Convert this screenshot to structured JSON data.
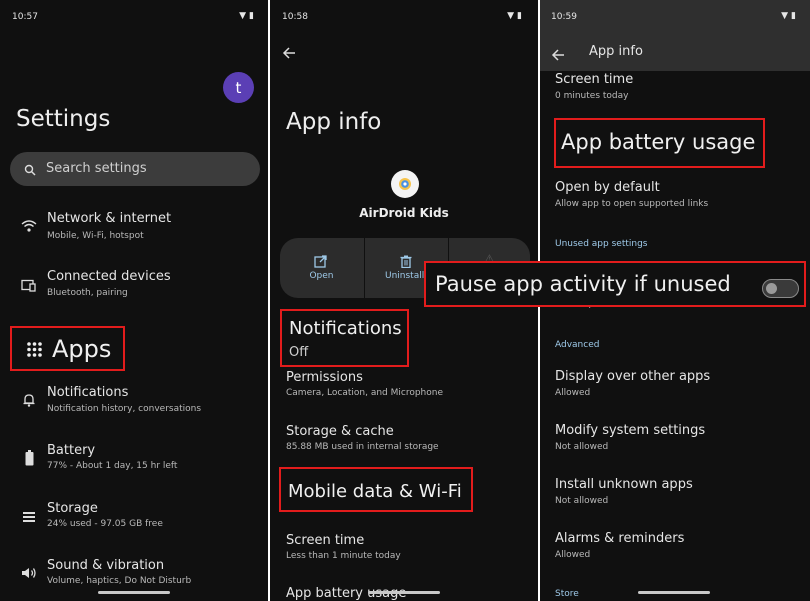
{
  "settings": {
    "time": "10:57",
    "avatar_letter": "t",
    "title": "Settings",
    "search_placeholder": "Search settings",
    "items": [
      {
        "icon": "wifi-icon",
        "title": "Network & internet",
        "subtitle": "Mobile, Wi-Fi, hotspot"
      },
      {
        "icon": "devices-icon",
        "title": "Connected devices",
        "subtitle": "Bluetooth, pairing"
      },
      {
        "icon": "apps-grid-icon",
        "title": "Apps",
        "subtitle": ""
      },
      {
        "icon": "bell-icon",
        "title": "Notifications",
        "subtitle": "Notification history, conversations"
      },
      {
        "icon": "battery-icon",
        "title": "Battery",
        "subtitle": "77% - About 1 day, 15 hr left"
      },
      {
        "icon": "storage-icon",
        "title": "Storage",
        "subtitle": "24% used - 97.05 GB free"
      },
      {
        "icon": "volume-icon",
        "title": "Sound & vibration",
        "subtitle": "Volume, haptics, Do Not Disturb"
      }
    ]
  },
  "appinfo": {
    "time": "10:58",
    "title": "App info",
    "app_name": "AirDroid Kids",
    "actions": [
      {
        "icon": "open-icon",
        "label": "Open"
      },
      {
        "icon": "trash-icon",
        "label": "Uninstall"
      }
    ],
    "notifications": {
      "title": "Notifications",
      "subtitle": "Off"
    },
    "permissions": {
      "title": "Permissions",
      "subtitle": "Camera, Location, and Microphone"
    },
    "storage": {
      "title": "Storage & cache",
      "subtitle": "85.88 MB used in internal storage"
    },
    "mobile_data": {
      "title": "Mobile data & Wi-Fi"
    },
    "screen_time": {
      "title": "Screen time",
      "subtitle": "Less than 1 minute today"
    },
    "battery_usage": {
      "title": "App battery usage"
    }
  },
  "appinfo2": {
    "time": "10:59",
    "title": "App info",
    "screen_time": {
      "title": "Screen time",
      "subtitle": "0 minutes today"
    },
    "battery_usage": {
      "title": "App battery usage"
    },
    "open_by_default": {
      "title": "Open by default",
      "subtitle": "Allow app to open supported links"
    },
    "unused_section": "Unused app settings",
    "pause_activity": {
      "title": "Pause app activity if unused",
      "enabled": false
    },
    "pause_sub_fragment": "and stop notifications",
    "advanced_section": "Advanced",
    "advanced_items": [
      {
        "title": "Display over other apps",
        "subtitle": "Allowed"
      },
      {
        "title": "Modify system settings",
        "subtitle": "Not allowed"
      },
      {
        "title": "Install unknown apps",
        "subtitle": "Not allowed"
      },
      {
        "title": "Alarms & reminders",
        "subtitle": "Allowed"
      }
    ],
    "store_section": "Store"
  },
  "colors": {
    "highlight": "#e21c1c",
    "background": "#101010",
    "avatar": "#5b3fb5",
    "accent": "#9ec9e8"
  }
}
